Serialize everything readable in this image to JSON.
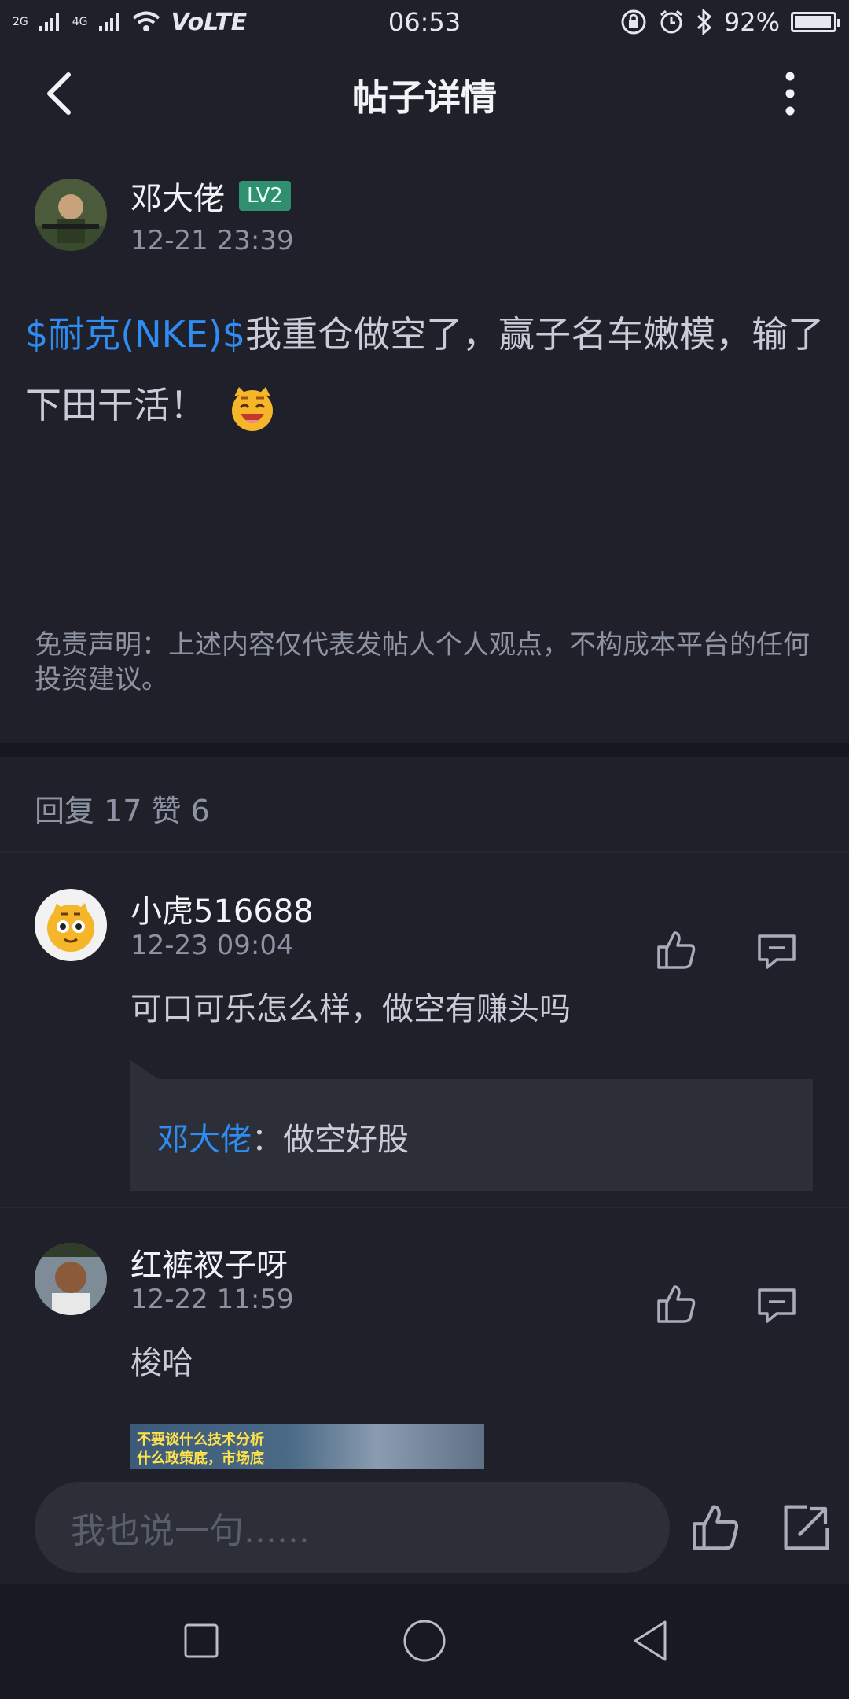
{
  "status_bar": {
    "signal_2g": "2G",
    "signal_4g": "4G",
    "volte": "VoLTE",
    "time": "06:53",
    "battery": "92%"
  },
  "header": {
    "title": "帖子详情"
  },
  "post": {
    "author": "邓大佬",
    "level": "LV2",
    "time": "12-21 23:39",
    "ticker": "$耐克(NKE)$",
    "body": "我重仓做空了，赢子名车嫩模，输了下田干活！",
    "disclaimer": "免责声明：上述内容仅代表发帖人个人观点，不构成本平台的任何投资建议。"
  },
  "stats": {
    "text": "回复 17 赞 6"
  },
  "comments": [
    {
      "name": "小虎516688",
      "time": "12-23 09:04",
      "text": "可口可乐怎么样，做空有赚头吗",
      "reply": {
        "author": "邓大佬",
        "separator": "：",
        "text": "做空好股"
      }
    },
    {
      "name": "红裤衩子呀",
      "time": "12-22 11:59",
      "text": "梭哈",
      "image_text": [
        "不要谈什么技术分析",
        "什么政策底，市场底"
      ]
    }
  ],
  "input": {
    "placeholder": "我也说一句......"
  },
  "colors": {
    "background": "#1f2029",
    "link_blue": "#2f8cf0",
    "level_badge": "#2f8f6e"
  },
  "icons": [
    "back-icon",
    "more-icon",
    "like-icon",
    "reply-icon",
    "share-icon",
    "nav-square-icon",
    "nav-circle-icon",
    "nav-back-triangle-icon"
  ]
}
